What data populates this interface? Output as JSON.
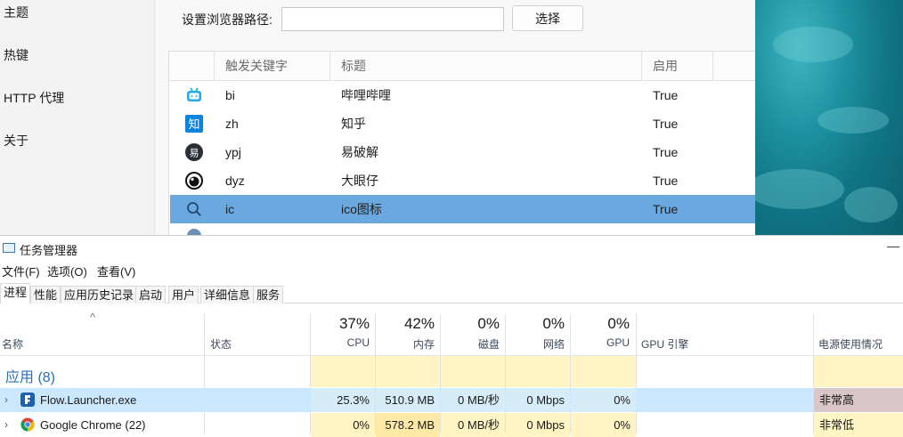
{
  "settings": {
    "nav": [
      "主题",
      "热键",
      "HTTP 代理",
      "关于"
    ],
    "browser_path_label": "设置浏览器路径:",
    "browser_path_value": "",
    "select_button": "选择",
    "table": {
      "headers": [
        "触发关键字",
        "标题",
        "启用"
      ],
      "rows": [
        {
          "icon": "bilibili-icon",
          "keyword": "bi",
          "title": "哔哩哔哩",
          "enabled": "True"
        },
        {
          "icon": "zhihu-icon",
          "keyword": "zh",
          "title": "知乎",
          "enabled": "True"
        },
        {
          "icon": "52pojie-icon",
          "keyword": "ypj",
          "title": "易破解",
          "enabled": "True"
        },
        {
          "icon": "big-eye-icon",
          "keyword": "dyz",
          "title": "大眼仔",
          "enabled": "True"
        },
        {
          "icon": "search-icon",
          "keyword": "ic",
          "title": "ico图标",
          "enabled": "True",
          "selected": true
        }
      ]
    }
  },
  "task_manager": {
    "title": "任务管理器",
    "menu": [
      "文件(F)",
      "选项(O)",
      "查看(V)"
    ],
    "tabs": [
      "进程",
      "性能",
      "应用历史记录",
      "启动",
      "用户",
      "详细信息",
      "服务"
    ],
    "active_tab": "进程",
    "columns": {
      "name": "名称",
      "status": "状态",
      "cpu": {
        "pct": "37%",
        "label": "CPU"
      },
      "memory": {
        "pct": "42%",
        "label": "内存"
      },
      "disk": {
        "pct": "0%",
        "label": "磁盘"
      },
      "network": {
        "pct": "0%",
        "label": "网络"
      },
      "gpu": {
        "pct": "0%",
        "label": "GPU"
      },
      "gpu_engine": "GPU 引擎",
      "power": "电源使用情况"
    },
    "group": "应用 (8)",
    "processes": [
      {
        "name": "Flow.Launcher.exe",
        "cpu": "25.3%",
        "memory": "510.9 MB",
        "disk": "0 MB/秒",
        "network": "0 Mbps",
        "gpu": "0%",
        "power": "非常高"
      },
      {
        "name": "Google Chrome (22)",
        "cpu": "0%",
        "memory": "578.2 MB",
        "disk": "0 MB/秒",
        "network": "0 Mbps",
        "gpu": "0%",
        "power": "非常低"
      }
    ],
    "colors": {
      "heat_light": "#fff4c4",
      "selected_row": "#cce8ff",
      "power_very_high": "#d9c6c8",
      "group_text": "#2a6fba"
    }
  }
}
